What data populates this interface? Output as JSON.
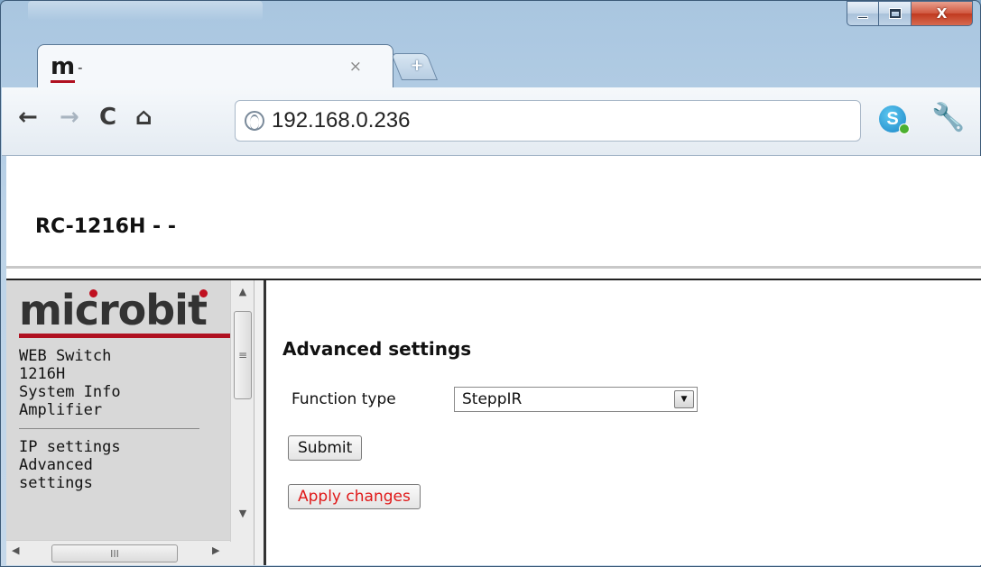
{
  "browser": {
    "tab_logo": "m",
    "tab_title": "-",
    "tab_close": "×",
    "new_tab": "+",
    "url": "192.168.0.236",
    "caption": {
      "close": "X"
    },
    "icons": {
      "back": "←",
      "forward": "→",
      "reload": "C",
      "home": "⌂",
      "wrench": "🔧"
    }
  },
  "header": {
    "device_title": "RC-1216H - -"
  },
  "sidebar": {
    "brand": "microbit",
    "brand_color": "#b01020",
    "group1": [
      "WEB Switch",
      "1216H",
      "System Info",
      "Amplifier"
    ],
    "group2": [
      "IP settings",
      "Advanced",
      "settings"
    ],
    "hscroll_grip": "III",
    "vscroll_grip": "≡"
  },
  "main": {
    "heading": "Advanced settings",
    "function_type_label": "Function type",
    "function_type_value": "SteppIR",
    "submit_label": "Submit",
    "apply_label": "Apply changes",
    "apply_color": "#e01818"
  }
}
